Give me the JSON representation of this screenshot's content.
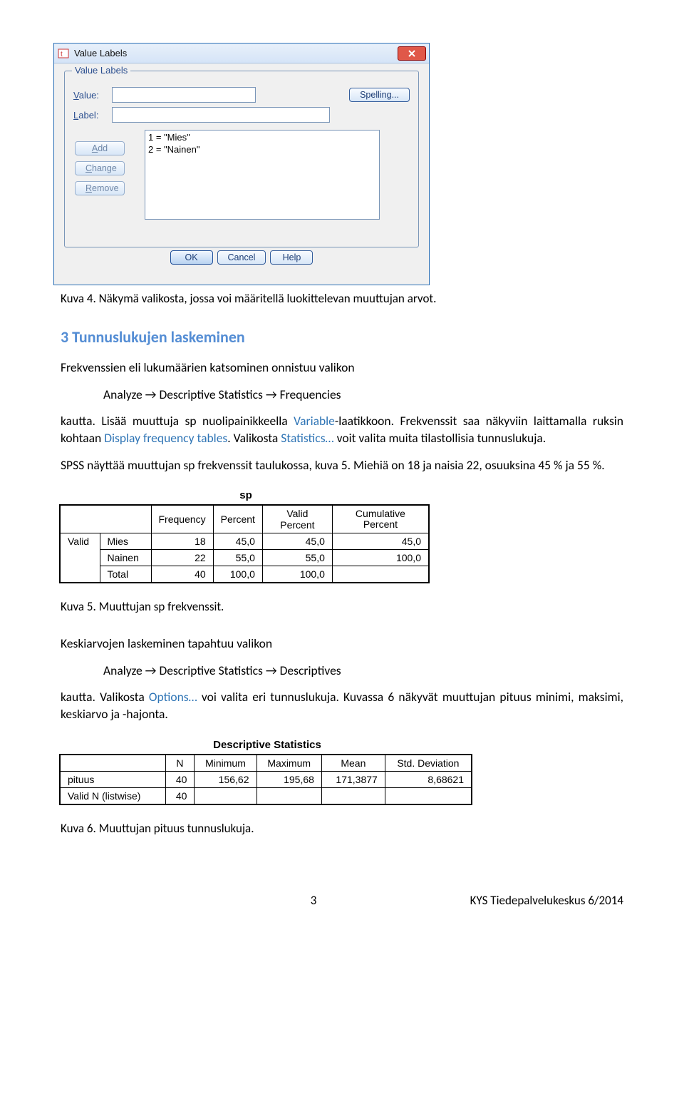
{
  "dialog": {
    "title": "Value Labels",
    "legend": "Value Labels",
    "value_label": "Value:",
    "label_label": "Label:",
    "spelling_btn": "Spelling...",
    "add_btn": "Add",
    "change_btn": "Change",
    "remove_btn": "Remove",
    "list_line1": "1 = \"Mies\"",
    "list_line2": "2 = \"Nainen\"",
    "ok_btn": "OK",
    "cancel_btn": "Cancel",
    "help_btn": "Help"
  },
  "caption4": "Kuva 4. Näkymä valikosta, jossa voi määritellä luokittelevan muuttujan arvot.",
  "h2": "3 Tunnuslukujen laskeminen",
  "p1a": "Frekvenssien eli lukumäärien katsominen onnistuu valikon",
  "p1b": "Analyze → Descriptive Statistics → Frequencies",
  "p1c_before": "kautta. Lisää muuttuja sp nuolipainikkeella ",
  "p1c_link1": "Variable",
  "p1c_mid": "-laatikkoon. Frekvenssit saa näkyviin laittamalla ruksin kohtaan ",
  "p1c_link2": "Display frequency tables",
  "p1c_mid2": ". Valikosta ",
  "p1c_link3": "Statistics…",
  "p1c_after": " voit valita muita tilastollisia tunnuslukuja.",
  "p2": "SPSS näyttää muuttujan sp frekvenssit taulukossa, kuva 5. Miehiä on 18 ja naisia 22, osuuksina 45 % ja 55 %.",
  "sp_title": "sp",
  "sp_headers": {
    "freq": "Frequency",
    "pct": "Percent",
    "vpct": "Valid Percent",
    "cpct": "Cumulative Percent"
  },
  "sp_rows": {
    "valid": "Valid",
    "mies": "Mies",
    "mies_f": "18",
    "mies_p": "45,0",
    "mies_vp": "45,0",
    "mies_cp": "45,0",
    "nainen": "Nainen",
    "nainen_f": "22",
    "nainen_p": "55,0",
    "nainen_vp": "55,0",
    "nainen_cp": "100,0",
    "total": "Total",
    "total_f": "40",
    "total_p": "100,0",
    "total_vp": "100,0"
  },
  "caption5": "Kuva 5. Muuttujan sp frekvenssit.",
  "p3": "Keskiarvojen laskeminen tapahtuu valikon",
  "p3b": "Analyze → Descriptive Statistics → Descriptives",
  "p4_before": "kautta. Valikosta ",
  "p4_link": "Options…",
  "p4_after": " voi valita eri tunnuslukuja. Kuvassa 6 näkyvät muuttujan pituus minimi, maksimi, keskiarvo ja -hajonta.",
  "ds_title": "Descriptive Statistics",
  "ds_headers": {
    "n": "N",
    "min": "Minimum",
    "max": "Maximum",
    "mean": "Mean",
    "sd": "Std. Deviation"
  },
  "ds_rows": {
    "pituus": "pituus",
    "p_n": "40",
    "p_min": "156,62",
    "p_max": "195,68",
    "p_mean": "171,3877",
    "p_sd": "8,68621",
    "validn": "Valid N (listwise)",
    "v_n": "40"
  },
  "caption6": "Kuva 6. Muuttujan pituus tunnuslukuja.",
  "footer_center": "3",
  "footer_right": "KYS Tiedepalvelukeskus 6/2014"
}
